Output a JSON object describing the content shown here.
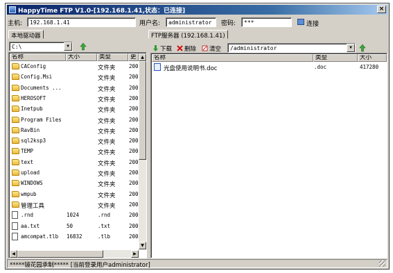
{
  "window": {
    "title": "HappyTime FTP V1.0-[192.168.1.41,状态：已连接]",
    "close_glyph": "×"
  },
  "connection": {
    "host_label": "主机:",
    "host_value": "192.168.1.41",
    "user_label": "用户名:",
    "user_value": "administrator",
    "password_label": "密码:",
    "password_value": "***",
    "connect_label": "连接"
  },
  "local": {
    "tab_label": "本地驱动器",
    "drive_value": "C:\\",
    "up_icon": "up-arrow-icon",
    "columns": [
      "名称",
      "大小",
      "类型",
      "更"
    ],
    "rows": [
      {
        "name": "CAConfig",
        "size": "",
        "type": "文件夹",
        "date": "200",
        "icon": "folder"
      },
      {
        "name": "Config.Msi",
        "size": "",
        "type": "文件夹",
        "date": "200",
        "icon": "folder"
      },
      {
        "name": "Documents ...",
        "size": "",
        "type": "文件夹",
        "date": "200",
        "icon": "folder"
      },
      {
        "name": "HEROSOFT",
        "size": "",
        "type": "文件夹",
        "date": "200",
        "icon": "folder"
      },
      {
        "name": "Inetpub",
        "size": "",
        "type": "文件夹",
        "date": "200",
        "icon": "folder"
      },
      {
        "name": "Program Files",
        "size": "",
        "type": "文件夹",
        "date": "200",
        "icon": "folder"
      },
      {
        "name": "RavBin",
        "size": "",
        "type": "文件夹",
        "date": "200",
        "icon": "folder"
      },
      {
        "name": "sql2ksp3",
        "size": "",
        "type": "文件夹",
        "date": "200",
        "icon": "folder"
      },
      {
        "name": "TEMP",
        "size": "",
        "type": "文件夹",
        "date": "200",
        "icon": "folder"
      },
      {
        "name": "text",
        "size": "",
        "type": "文件夹",
        "date": "200",
        "icon": "folder"
      },
      {
        "name": "upload",
        "size": "",
        "type": "文件夹",
        "date": "200",
        "icon": "folder"
      },
      {
        "name": "WINDOWS",
        "size": "",
        "type": "文件夹",
        "date": "200",
        "icon": "folder"
      },
      {
        "name": "wmpub",
        "size": "",
        "type": "文件夹",
        "date": "200",
        "icon": "folder"
      },
      {
        "name": "管理工具",
        "size": "",
        "type": "文件夹",
        "date": "200",
        "icon": "folder"
      },
      {
        "name": ".rnd",
        "size": "1024",
        "type": ".rnd",
        "date": "200",
        "icon": "file"
      },
      {
        "name": "aa.txt",
        "size": "50",
        "type": ".txt",
        "date": "200",
        "icon": "file"
      },
      {
        "name": "amcompat.tlb",
        "size": "16832",
        "type": ".tlb",
        "date": "200",
        "icon": "file"
      }
    ]
  },
  "remote": {
    "tab_label": "FTP服务器 (192.168.1.41)",
    "download_label": "下载",
    "delete_label": "删除",
    "clear_label": "清空",
    "path_value": "/administrator",
    "columns": [
      "名称",
      "类型",
      "大小"
    ],
    "rows": [
      {
        "name": "光盘使用说明书.doc",
        "type": ".doc",
        "size": "417280",
        "icon": "doc"
      }
    ]
  },
  "status": {
    "text": "*****镜花园承制***** [当前登录用户administrator]"
  },
  "colors": {
    "titlebar": "#0a246a",
    "chrome": "#d4d0c8",
    "folder": "#e9b93c"
  }
}
